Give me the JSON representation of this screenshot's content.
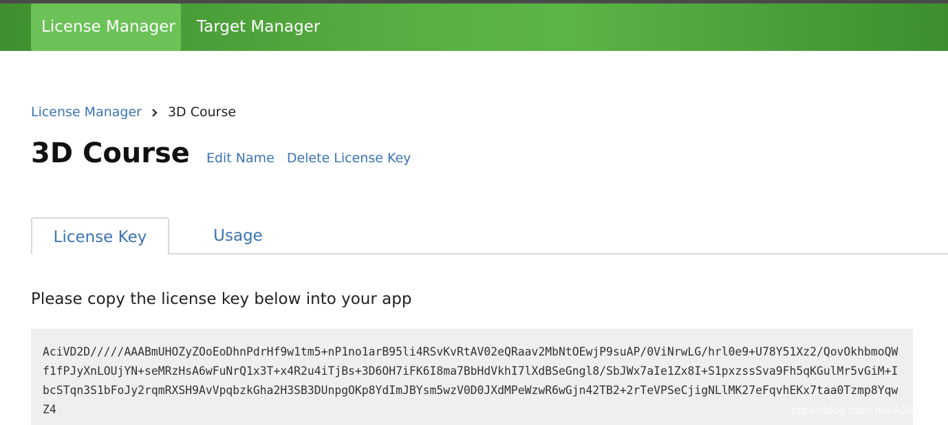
{
  "nav": {
    "items": [
      {
        "label": "License Manager",
        "active": true
      },
      {
        "label": "Target Manager",
        "active": false
      }
    ]
  },
  "breadcrumb": {
    "parent": "License Manager",
    "current": "3D Course"
  },
  "header": {
    "title": "3D Course",
    "edit_name": "Edit Name",
    "delete_key": "Delete License Key"
  },
  "tabs": [
    {
      "label": "License Key",
      "active": true
    },
    {
      "label": "Usage",
      "active": false
    }
  ],
  "content": {
    "instruction": "Please copy the license key below into your app",
    "license_key": "AciVD2D/////AAABmUHOZyZOoEoDhnPdrHf9w1tm5+nP1no1arB95li4RSvKvRtAV02eQRaav2MbNtOEwjP9suAP/0ViNrwLG/hrl0e9+U78Y51Xz2/QovOkhbmoQWf1fPJyXnLOUjYN+seMRzHsA6wFuNrQ1x3T+x4R2u4iTjBs+3D6OH7iFK6I8ma7BbHdVkhI7lXdBSeGngl8/SbJWx7aIe1Zx8I+S1pxzssSva9Fh5qKGulMr5vGiM+IbcSTqn3S1bFoJy2rqmRXSH9AvVpqbzkGha2H3SB3DUnpgOKp8YdImJBYsm5wzV0D0JXdMPeWzwR6wGjn42TB2+2rTeVPSeCjigNLlMK27eFqvhEKx7taa0Tzmp8YqwZ4"
  },
  "watermark": "https://blog.csdn.net/AJANEEE",
  "colors": {
    "nav_green": "#58b043",
    "nav_active": "#6cc257",
    "link_blue": "#3a73b3",
    "key_bg": "#efefef"
  }
}
